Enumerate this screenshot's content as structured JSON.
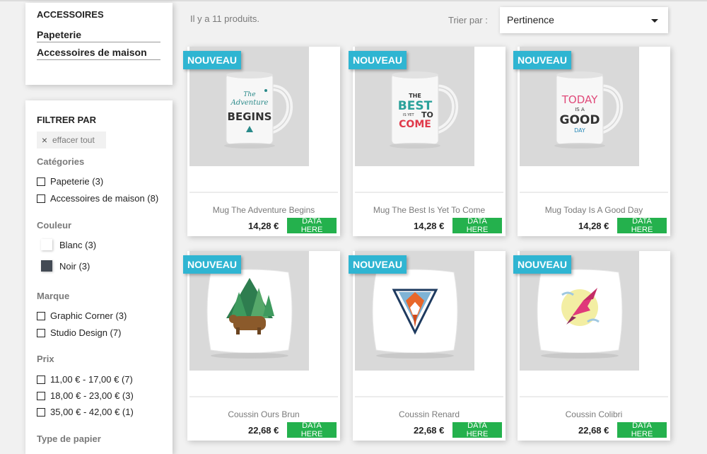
{
  "sidebar": {
    "category_title": "ACCESSOIRES",
    "category_links": [
      "Papeterie",
      "Accessoires de maison"
    ],
    "filter_title": "FILTRER PAR",
    "clear_all": "effacer tout",
    "sections": {
      "categories": "Catégories",
      "color": "Couleur",
      "brand": "Marque",
      "price": "Prix",
      "paper": "Type de papier"
    },
    "categories": [
      "Papeterie (3)",
      "Accessoires de maison (8)"
    ],
    "colors": [
      {
        "label": "Blanc (3)",
        "hex": "#ffffff"
      },
      {
        "label": "Noir (3)",
        "hex": "#434a54"
      }
    ],
    "brands": [
      "Graphic Corner (3)",
      "Studio Design (7)"
    ],
    "prices": [
      "11,00 € - 17,00 € (7)",
      "18,00 € - 23,00 € (3)",
      "35,00 € - 42,00 € (1)"
    ]
  },
  "topbar": {
    "count": "Il y a 11 produits.",
    "sort_label": "Trier par :",
    "sort_value": "Pertinence"
  },
  "products": [
    {
      "badge": "NOUVEAU",
      "name": "Mug The Adventure Begins",
      "price": "14,28 €",
      "button": "DATA HERE"
    },
    {
      "badge": "NOUVEAU",
      "name": "Mug The Best Is Yet To Come",
      "price": "14,28 €",
      "button": "DATA HERE"
    },
    {
      "badge": "NOUVEAU",
      "name": "Mug Today Is A Good Day",
      "price": "14,28 €",
      "button": "DATA HERE"
    },
    {
      "badge": "NOUVEAU",
      "name": "Coussin Ours Brun",
      "price": "22,68 €",
      "button": "DATA HERE"
    },
    {
      "badge": "NOUVEAU",
      "name": "Coussin Renard",
      "price": "22,68 €",
      "button": "DATA HERE"
    },
    {
      "badge": "NOUVEAU",
      "name": "Coussin Colibri",
      "price": "22,68 €",
      "button": "DATA HERE"
    }
  ],
  "artwork_text": {
    "mug1": [
      "The",
      "Adventure",
      "BEGINS"
    ],
    "mug2": [
      "THE",
      "BEST",
      "IS YET",
      "TO",
      "COME"
    ],
    "mug3": [
      "TODAY",
      "IS A",
      "GOOD",
      "DAY"
    ]
  },
  "colors": {
    "badge": "#2fb5d2",
    "button": "#24b14d",
    "muted_text": "#7a7a7a"
  }
}
